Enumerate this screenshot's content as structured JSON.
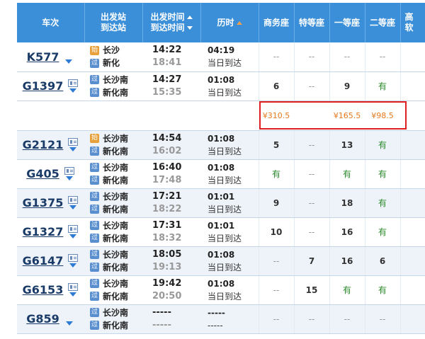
{
  "header": {
    "train": "车次",
    "station_dep": "出发站",
    "station_arr": "到达站",
    "time_dep": "出发时间",
    "time_arr": "到达时间",
    "duration": "历时",
    "business": "商务座",
    "special": "特等座",
    "first": "一等座",
    "second": "二等座",
    "soft_sleeper_top": "高",
    "soft_sleeper_bot": "软"
  },
  "trains": [
    {
      "no": "K577",
      "card": false,
      "dep_badge": "始",
      "dep_station": "长沙",
      "arr_badge": "过",
      "arr_station": "新化",
      "dep_time": "14:22",
      "arr_time": "18:41",
      "dur": "04:19",
      "arrive_day": "当日到达",
      "business": "--",
      "special": "--",
      "first": "--",
      "second": "--"
    },
    {
      "no": "G1397",
      "card": true,
      "dep_badge": "过",
      "dep_station": "长沙南",
      "arr_badge": "过",
      "arr_station": "新化南",
      "dep_time": "14:27",
      "arr_time": "15:35",
      "dur": "01:08",
      "arrive_day": "当日到达",
      "business": "6",
      "special": "--",
      "first": "9",
      "second": "有"
    },
    {
      "no": "G2121",
      "card": true,
      "dep_badge": "始",
      "dep_station": "长沙南",
      "arr_badge": "过",
      "arr_station": "新化南",
      "dep_time": "14:54",
      "arr_time": "16:02",
      "dur": "01:08",
      "arrive_day": "当日到达",
      "business": "5",
      "special": "--",
      "first": "13",
      "second": "有"
    },
    {
      "no": "G405",
      "card": true,
      "dep_badge": "过",
      "dep_station": "长沙南",
      "arr_badge": "过",
      "arr_station": "新化南",
      "dep_time": "16:40",
      "arr_time": "17:48",
      "dur": "01:08",
      "arrive_day": "当日到达",
      "business": "有",
      "special": "--",
      "first": "有",
      "second": "有"
    },
    {
      "no": "G1375",
      "card": true,
      "dep_badge": "过",
      "dep_station": "长沙南",
      "arr_badge": "过",
      "arr_station": "新化南",
      "dep_time": "17:21",
      "arr_time": "18:22",
      "dur": "01:01",
      "arrive_day": "当日到达",
      "business": "9",
      "special": "--",
      "first": "18",
      "second": "有"
    },
    {
      "no": "G1327",
      "card": true,
      "dep_badge": "过",
      "dep_station": "长沙南",
      "arr_badge": "过",
      "arr_station": "新化南",
      "dep_time": "17:31",
      "arr_time": "18:32",
      "dur": "01:01",
      "arrive_day": "当日到达",
      "business": "10",
      "special": "--",
      "first": "16",
      "second": "有"
    },
    {
      "no": "G6147",
      "card": true,
      "dep_badge": "过",
      "dep_station": "长沙南",
      "arr_badge": "过",
      "arr_station": "新化南",
      "dep_time": "18:05",
      "arr_time": "19:13",
      "dur": "01:08",
      "arrive_day": "当日到达",
      "business": "--",
      "special": "7",
      "first": "16",
      "second": "6"
    },
    {
      "no": "G6153",
      "card": true,
      "dep_badge": "过",
      "dep_station": "长沙南",
      "arr_badge": "过",
      "arr_station": "新化南",
      "dep_time": "19:42",
      "arr_time": "20:50",
      "dur": "01:08",
      "arrive_day": "当日到达",
      "business": "--",
      "special": "15",
      "first": "有",
      "second": "有"
    },
    {
      "no": "G859",
      "card": false,
      "dep_badge": "过",
      "dep_station": "长沙南",
      "arr_badge": "过",
      "arr_station": "新化南",
      "dep_time": "-----",
      "arr_time": "-----",
      "dur": "-----",
      "arrive_day": "-----",
      "business": "--",
      "special": "--",
      "first": "--",
      "second": "--"
    }
  ],
  "prices": {
    "business": "¥310.5",
    "special": "",
    "first": "¥165.5",
    "second": "¥98.5"
  },
  "colors": {
    "header_bg": "#3a8fd8",
    "train_no": "#1a3b67",
    "price": "#e67a1f",
    "highlight_border": "#e02020",
    "available": "#2b8a2b"
  }
}
